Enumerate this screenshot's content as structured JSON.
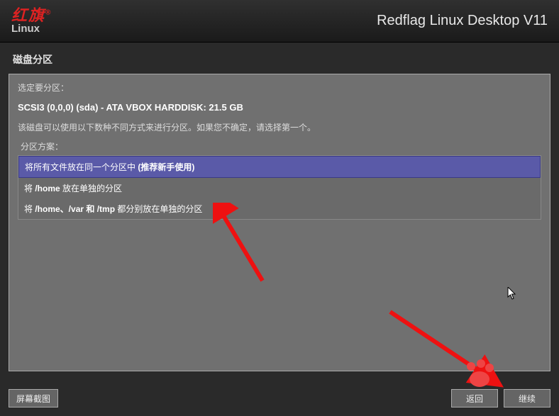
{
  "header": {
    "logo_cn": "红旗",
    "logo_en": "Linux",
    "title": "Redflag Linux Desktop V11"
  },
  "section_title": "磁盘分区",
  "panel": {
    "select_label": "选定要分区：",
    "disk": "SCSI3 (0,0,0) (sda) - ATA VBOX HARDDISK: 21.5 GB",
    "hint": "该磁盘可以使用以下数种不同方式来进行分区。如果您不确定，请选择第一个。",
    "scheme_label": "分区方案：",
    "options": [
      {
        "prefix": "将所有文件放在同一个分区中 ",
        "paths": "",
        "suffix": "(推荐新手使用)",
        "selected": true
      },
      {
        "prefix": "将 ",
        "paths": "/home",
        "suffix": " 放在单独的分区",
        "selected": false
      },
      {
        "prefix": "将 ",
        "paths": "/home、/var 和 /tmp",
        "suffix": " 都分别放在单独的分区",
        "selected": false
      }
    ]
  },
  "footer": {
    "screenshot": "屏幕截图",
    "back": "返回",
    "continue": "继续"
  }
}
